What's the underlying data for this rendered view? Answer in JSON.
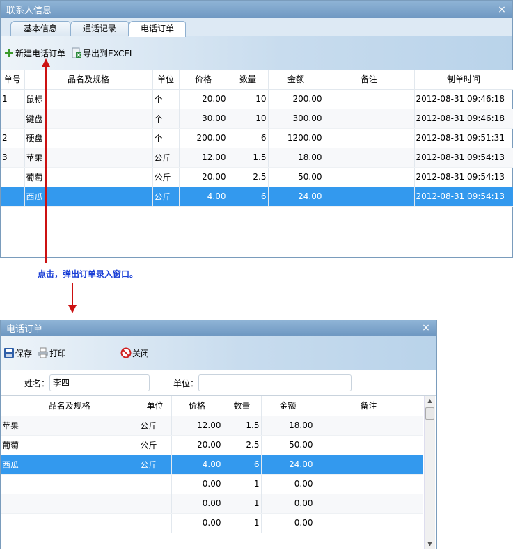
{
  "contact_window": {
    "title": "联系人信息",
    "close_label": "×",
    "tabs": [
      "基本信息",
      "通话记录",
      "电话订单"
    ],
    "toolbar": {
      "new_order": "新建电话订单",
      "export_excel": "导出到EXCEL"
    },
    "columns": [
      "单号",
      "品名及规格",
      "单位",
      "价格",
      "数量",
      "金额",
      "备注",
      "制单时间"
    ],
    "rows": [
      {
        "no": "1",
        "name": "鼠标",
        "unit": "个",
        "price": "20.00",
        "qty": "10",
        "amount": "200.00",
        "note": "",
        "time": "2012-08-31 09:46:18"
      },
      {
        "no": "",
        "name": "键盘",
        "unit": "个",
        "price": "30.00",
        "qty": "10",
        "amount": "300.00",
        "note": "",
        "time": "2012-08-31 09:46:18"
      },
      {
        "no": "2",
        "name": "硬盘",
        "unit": "个",
        "price": "200.00",
        "qty": "6",
        "amount": "1200.00",
        "note": "",
        "time": "2012-08-31 09:51:31"
      },
      {
        "no": "3",
        "name": "苹果",
        "unit": "公斤",
        "price": "12.00",
        "qty": "1.5",
        "amount": "18.00",
        "note": "",
        "time": "2012-08-31 09:54:13"
      },
      {
        "no": "",
        "name": "葡萄",
        "unit": "公斤",
        "price": "20.00",
        "qty": "2.5",
        "amount": "50.00",
        "note": "",
        "time": "2012-08-31 09:54:13"
      },
      {
        "no": "",
        "name": "西瓜",
        "unit": "公斤",
        "price": "4.00",
        "qty": "6",
        "amount": "24.00",
        "note": "",
        "time": "2012-08-31 09:54:13"
      }
    ]
  },
  "annotation": {
    "text": "点击，弹出订单录入窗口。",
    "color": "#1a3fd6",
    "arrow_color": "#cc1111"
  },
  "order_window": {
    "title": "电话订单",
    "close_label": "×",
    "toolbar": {
      "save": "保存",
      "print": "打印",
      "close": "关闭"
    },
    "form": {
      "name_label": "姓名：",
      "name_value": "李四",
      "unit_label": "单位：",
      "unit_value": ""
    },
    "columns": [
      "品名及规格",
      "单位",
      "价格",
      "数量",
      "金额",
      "备注"
    ],
    "rows": [
      {
        "name": "苹果",
        "unit": "公斤",
        "price": "12.00",
        "qty": "1.5",
        "amount": "18.00",
        "note": ""
      },
      {
        "name": "葡萄",
        "unit": "公斤",
        "price": "20.00",
        "qty": "2.5",
        "amount": "50.00",
        "note": ""
      },
      {
        "name": "西瓜",
        "unit": "公斤",
        "price": "4.00",
        "qty": "6",
        "amount": "24.00",
        "note": ""
      },
      {
        "name": "",
        "unit": "",
        "price": "0.00",
        "qty": "1",
        "amount": "0.00",
        "note": ""
      },
      {
        "name": "",
        "unit": "",
        "price": "0.00",
        "qty": "1",
        "amount": "0.00",
        "note": ""
      },
      {
        "name": "",
        "unit": "",
        "price": "0.00",
        "qty": "1",
        "amount": "0.00",
        "note": ""
      }
    ]
  },
  "colors": {
    "title_bar": "#7fa6cc",
    "selection": "#3399ee",
    "window_border": "#7a9cbc"
  }
}
